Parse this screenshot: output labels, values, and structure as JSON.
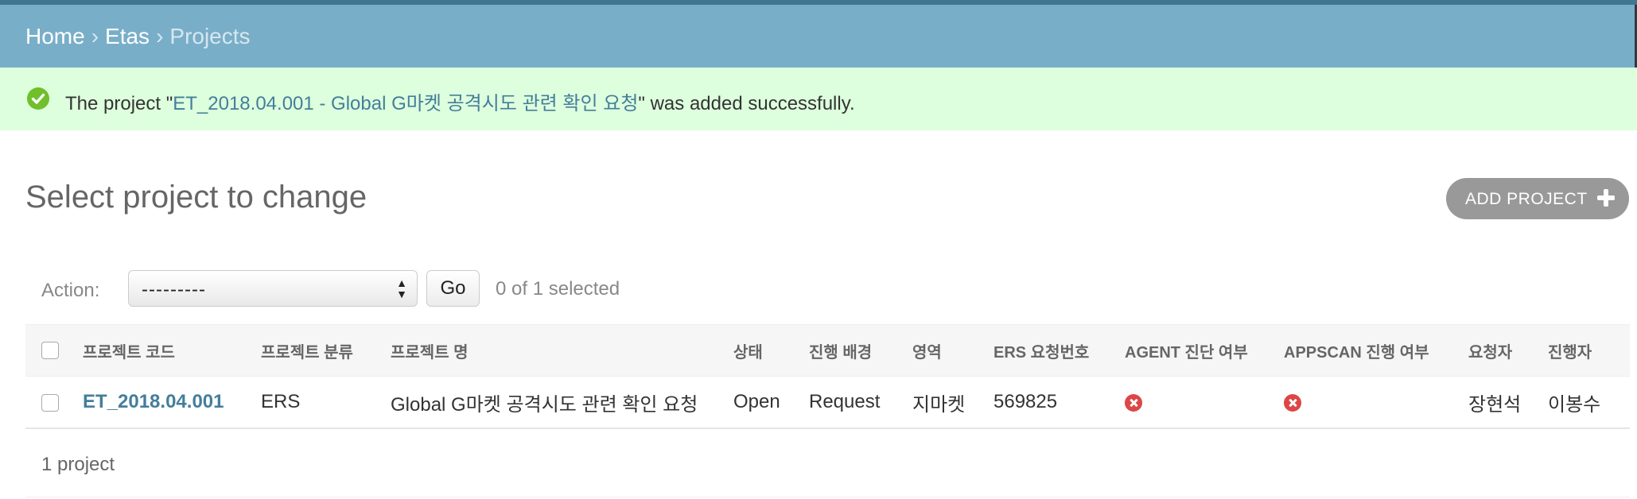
{
  "breadcrumbs": {
    "home": "Home",
    "app": "Etas",
    "current": "Projects",
    "separator": "›"
  },
  "message": {
    "prefix": "The project \"",
    "link": "ET_2018.04.001 - Global G마켓 공격시도 관련 확인 요청",
    "suffix": "\" was added successfully.",
    "icon": "success-check-icon"
  },
  "page": {
    "title": "Select project to change",
    "add_button": "ADD PROJECT"
  },
  "actions": {
    "label": "Action:",
    "selected_option": "---------",
    "go": "Go",
    "selection_count": "0 of 1 selected"
  },
  "table": {
    "headers": [
      "프로젝트 코드",
      "프로젝트 분류",
      "프로젝트 명",
      "상태",
      "진행 배경",
      "영역",
      "ERS 요청번호",
      "AGENT 진단 여부",
      "APPSCAN 진행 여부",
      "요청자",
      "진행자"
    ],
    "rows": [
      {
        "code": "ET_2018.04.001",
        "category": "ERS",
        "name": "Global G마켓 공격시도 관련 확인 요청",
        "status": "Open",
        "background": "Request",
        "area": "지마켓",
        "ers_no": "569825",
        "agent": "no-icon",
        "appscan": "no-icon",
        "requester": "장현석",
        "assignee": "이봉수"
      }
    ]
  },
  "paginator": {
    "count": "1 project"
  },
  "colors": {
    "breadcrumb_bg": "#79aec8",
    "header_line": "#417690",
    "success_bg": "#ddffdd",
    "link": "#447e9b",
    "add_button": "#999999",
    "no_icon": "#dd4646"
  }
}
